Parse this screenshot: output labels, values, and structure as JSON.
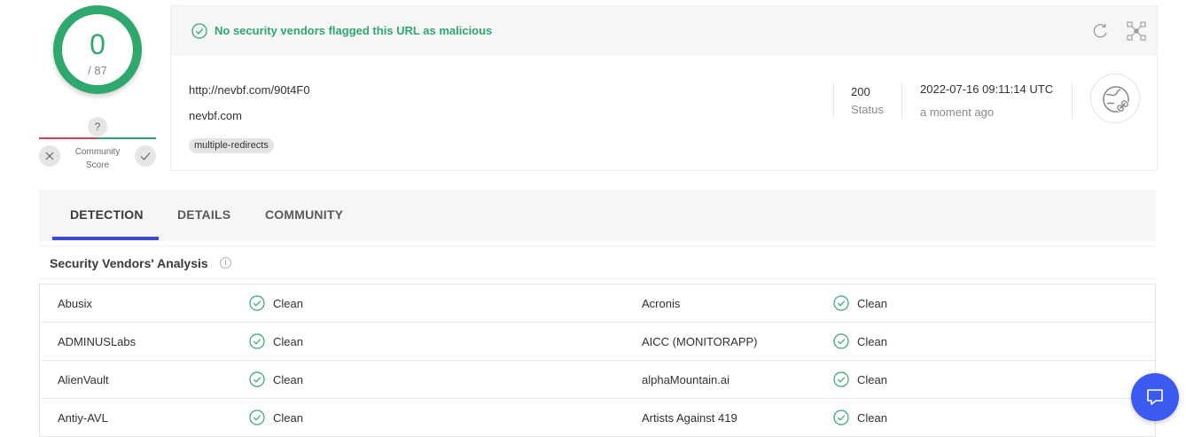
{
  "score": {
    "detections": "0",
    "total": "/ 87",
    "color": "#2fa86e"
  },
  "community": {
    "marker": "?",
    "label_line1": "Community",
    "label_line2": "Score",
    "dislike_icon": "x-icon",
    "like_icon": "check-icon"
  },
  "banner": {
    "icon": "check-circle-icon",
    "text": "No security vendors flagged this URL as malicious",
    "color": "#2fa86e"
  },
  "header_actions": {
    "reanalyze_icon": "refresh-icon",
    "similar_icon": "graph-icon"
  },
  "url_info": {
    "url": "http://nevbf.com/90t4F0",
    "domain": "nevbf.com",
    "tags": [
      "multiple-redirects"
    ],
    "status_code": "200",
    "status_label": "Status",
    "date": "2022-07-16 09:11:14 UTC",
    "relative_time": "a moment ago",
    "type_icon": "globe-link-icon"
  },
  "tabs": [
    {
      "label": "DETECTION",
      "active": true
    },
    {
      "label": "DETAILS",
      "active": false
    },
    {
      "label": "COMMUNITY",
      "active": false
    }
  ],
  "accent_color": "#3b47e0",
  "vendors_section": {
    "title": "Security Vendors' Analysis",
    "info_icon": "info-icon"
  },
  "vendors": [
    {
      "left": {
        "name": "Abusix",
        "result": "Clean"
      },
      "right": {
        "name": "Acronis",
        "result": "Clean"
      }
    },
    {
      "left": {
        "name": "ADMINUSLabs",
        "result": "Clean"
      },
      "right": {
        "name": "AICC (MONITORAPP)",
        "result": "Clean"
      }
    },
    {
      "left": {
        "name": "AlienVault",
        "result": "Clean"
      },
      "right": {
        "name": "alphaMountain.ai",
        "result": "Clean"
      }
    },
    {
      "left": {
        "name": "Antiy-AVL",
        "result": "Clean"
      },
      "right": {
        "name": "Artists Against 419",
        "result": "Clean"
      }
    }
  ],
  "chat": {
    "icon": "chat-icon",
    "color": "#3b5bf0"
  }
}
